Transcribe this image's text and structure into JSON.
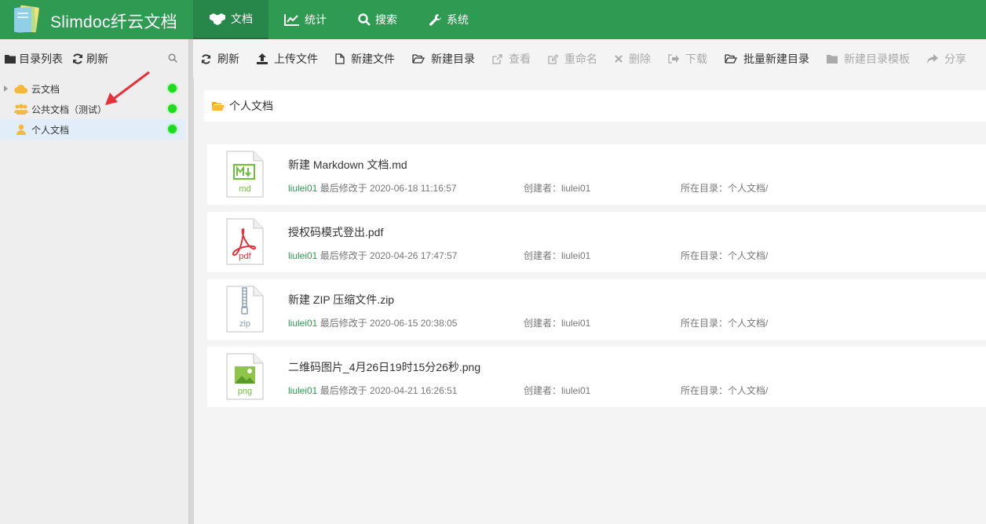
{
  "header": {
    "brand": "Slimdoc纤云文档",
    "nav": [
      {
        "label": "文档",
        "icon": "cubes-icon",
        "active": true
      },
      {
        "label": "统计",
        "icon": "line-chart-icon",
        "active": false
      },
      {
        "label": "搜索",
        "icon": "search-icon",
        "active": false
      },
      {
        "label": "系统",
        "icon": "wrench-icon",
        "active": false
      }
    ]
  },
  "sidebar": {
    "title": "目录列表",
    "refresh": "刷新",
    "items": [
      {
        "label": "云文档",
        "icon": "cloud-icon",
        "status_color": "#1ddc1d"
      },
      {
        "label": "公共文档（测试）",
        "icon": "users-icon",
        "status_color": "#1ddc1d"
      },
      {
        "label": "个人文档",
        "icon": "user-icon",
        "status_color": "#1ddc1d",
        "selected": true
      }
    ]
  },
  "toolbar": {
    "buttons": [
      {
        "label": "刷新",
        "icon": "refresh-icon",
        "enabled": true
      },
      {
        "label": "上传文件",
        "icon": "upload-icon",
        "enabled": true
      },
      {
        "label": "新建文件",
        "icon": "file-icon",
        "enabled": true
      },
      {
        "label": "新建目录",
        "icon": "folder-open-icon",
        "enabled": true
      },
      {
        "label": "查看",
        "icon": "external-link-icon",
        "enabled": false
      },
      {
        "label": "重命名",
        "icon": "edit-icon",
        "enabled": false
      },
      {
        "label": "删除",
        "icon": "times-icon",
        "enabled": false
      },
      {
        "label": "下载",
        "icon": "sign-out-icon",
        "enabled": false
      },
      {
        "label": "批量新建目录",
        "icon": "folder-open-icon",
        "enabled": true
      },
      {
        "label": "新建目录模板",
        "icon": "folder-icon",
        "enabled": false
      },
      {
        "label": "分享",
        "icon": "share-icon",
        "enabled": false
      }
    ]
  },
  "breadcrumb": {
    "label": "个人文档"
  },
  "files": [
    {
      "name": "新建 Markdown 文档.md",
      "type": "md",
      "user": "liulei01",
      "modified": "最后修改于 2020-06-18 11:16:57",
      "creator": "创建者：liulei01",
      "dir": "所在目录：个人文档/"
    },
    {
      "name": "授权码模式登出.pdf",
      "type": "pdf",
      "user": "liulei01",
      "modified": "最后修改于 2020-04-26 17:47:57",
      "creator": "创建者：liulei01",
      "dir": "所在目录：个人文档/"
    },
    {
      "name": "新建 ZIP 压缩文件.zip",
      "type": "zip",
      "user": "liulei01",
      "modified": "最后修改于 2020-06-15 20:38:05",
      "creator": "创建者：liulei01",
      "dir": "所在目录：个人文档/"
    },
    {
      "name": "二维码图片_4月26日19时15分26秒.png",
      "type": "png",
      "user": "liulei01",
      "modified": "最后修改于 2020-04-21 16:26:51",
      "creator": "创建者：liulei01",
      "dir": "所在目录：个人文档/"
    }
  ],
  "colors": {
    "brand": "#2f9a52",
    "status": "#1ddc1d",
    "annotation": "#e8303a"
  }
}
